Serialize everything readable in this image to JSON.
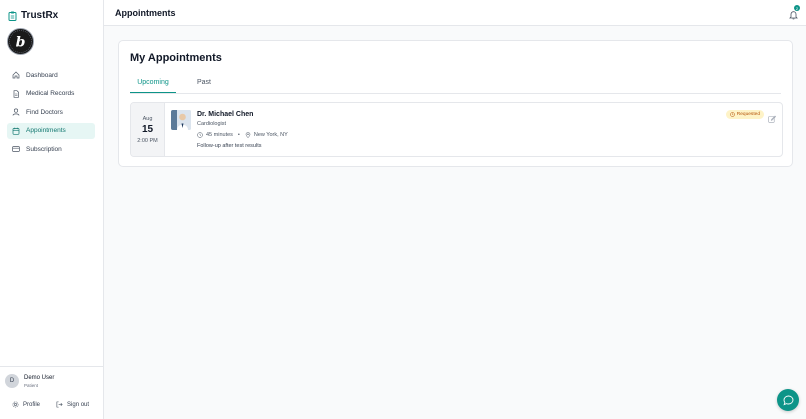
{
  "app": {
    "brand": "TrustRx"
  },
  "sidebar": {
    "items": [
      {
        "label": "Dashboard",
        "icon": "home-icon"
      },
      {
        "label": "Medical Records",
        "icon": "file-icon"
      },
      {
        "label": "Find Doctors",
        "icon": "user-icon"
      },
      {
        "label": "Appointments",
        "icon": "calendar-icon",
        "active": true
      },
      {
        "label": "Subscription",
        "icon": "credit-card-icon"
      }
    ]
  },
  "user": {
    "initial": "D",
    "name": "Demo User",
    "role": "Patient",
    "profile_label": "Profile",
    "signout_label": "Sign out"
  },
  "header": {
    "title": "Appointments",
    "notification_count": "2"
  },
  "main": {
    "title": "My Appointments",
    "tabs": [
      {
        "label": "Upcoming",
        "active": true
      },
      {
        "label": "Past",
        "active": false
      }
    ],
    "appointments": [
      {
        "month": "Aug",
        "day": "15",
        "time": "2:00 PM",
        "doctor": "Dr. Michael Chen",
        "specialty": "Cardiologist",
        "duration": "45 minutes",
        "separator": "•",
        "location": "New York, NY",
        "note": "Follow-up after test results",
        "status": "Requested"
      }
    ]
  },
  "colors": {
    "accent": "#0d9488",
    "active_bg": "#e6f6f4",
    "status_bg": "#fef3c7",
    "status_text": "#b45309"
  }
}
